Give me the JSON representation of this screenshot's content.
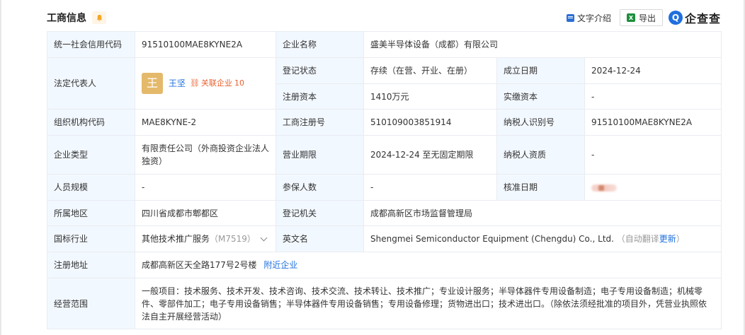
{
  "header": {
    "title": "工商信息",
    "text_intro": "文字介绍",
    "export_label": "导出",
    "brand": "企查查",
    "brand_mark": "Q"
  },
  "rows": {
    "credit_code_label": "统一社会信用代码",
    "credit_code": "91510100MAE8KYNE2A",
    "company_name_label": "企业名称",
    "company_name": "盛美半导体设备（成都）有限公司",
    "legal_rep_label": "法定代表人",
    "legal_rep_avatar": "王",
    "legal_rep_name": "王坚",
    "assoc_label": "关联企业",
    "assoc_count": "10",
    "reg_status_label": "登记状态",
    "reg_status": "存续（在营、开业、在册）",
    "est_date_label": "成立日期",
    "est_date": "2024-12-24",
    "reg_capital_label": "注册资本",
    "reg_capital": "1410万元",
    "paid_capital_label": "实缴资本",
    "paid_capital": "-",
    "org_code_label": "组织机构代码",
    "org_code": "MAE8KYNE-2",
    "biz_reg_no_label": "工商注册号",
    "biz_reg_no": "510109003851914",
    "taxpayer_id_label": "纳税人识别号",
    "taxpayer_id": "91510100MAE8KYNE2A",
    "company_type_label": "企业类型",
    "company_type": "有限责任公司（外商投资企业法人独资）",
    "biz_term_label": "营业期限",
    "biz_term": "2024-12-24 至无固定期限",
    "taxpayer_qual_label": "纳税人资质",
    "taxpayer_qual": "-",
    "staff_size_label": "人员规模",
    "staff_size": "-",
    "insured_label": "参保人数",
    "insured": "-",
    "approval_date_label": "核准日期",
    "region_label": "所属地区",
    "region": "四川省成都市郫都区",
    "reg_authority_label": "登记机关",
    "reg_authority": "成都高新区市场监督管理局",
    "industry_label": "国标行业",
    "industry": "其他技术推广服务",
    "industry_code": "（M7519）",
    "en_name_label": "英文名",
    "en_name": "Shengmei Semiconductor Equipment (Chengdu) Co., Ltd.",
    "auto_translate": "（自动翻译",
    "update_label": "更新",
    "close_paren": "）",
    "address_label": "注册地址",
    "address": "成都高新区天全路177号2号楼",
    "nearby_label": "附近企业",
    "scope_label": "经营范围",
    "scope": "一般项目：技术服务、技术开发、技术咨询、技术交流、技术转让、技术推广；专业设计服务；半导体器件专用设备制造；电子专用设备制造；机械零件、零部件加工；电子专用设备销售；半导体器件专用设备销售；专用设备修理；货物进出口；技术进出口。（除依法须经批准的项目外，凭营业执照依法自主开展经营活动）"
  }
}
